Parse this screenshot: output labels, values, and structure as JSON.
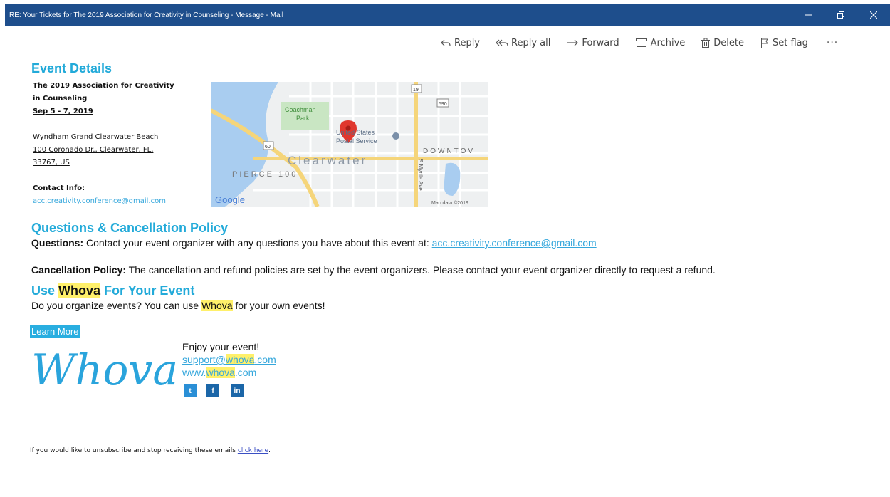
{
  "window": {
    "title": "RE: Your Tickets for The 2019 Association for Creativity in Counseling - Message - Mail",
    "controls": [
      "–",
      "❐",
      "✕"
    ]
  },
  "toolbar": {
    "reply": "Reply",
    "reply_all": "Reply all",
    "forward": "Forward",
    "archive": "Archive",
    "delete": "Delete",
    "set_flag": "Set flag",
    "more": "···"
  },
  "event": {
    "heading": "Event Details",
    "title_line1": "The 2019 Association for Creativity",
    "title_line2": "in Counseling",
    "dates": "Sep 5 - 7, 2019",
    "venue": "Wyndham Grand Clearwater Beach",
    "address_line1": "100 Coronado Dr., Clearwater, FL,",
    "address_line2": "33767, US",
    "contact_label": "Contact Info:",
    "contact_email": "acc.creativity.conference@gmail.com"
  },
  "map": {
    "labels": {
      "park": "Coachman",
      "park2": "Park",
      "post1": "United States",
      "post2": "Postal Service",
      "city": "Clearwater",
      "downtown": "DOWNTOV",
      "pierce": "PIERCE 100",
      "street": "S Myrtle Ave",
      "google": "Google",
      "attribution": "Map data ©2019",
      "route_19": "19",
      "route_590": "590",
      "route_60": "60"
    }
  },
  "policy": {
    "heading": "Questions & Cancellation Policy",
    "questions_label": "Questions:",
    "questions_text": " Contact your event organizer with any questions you have about this event at: ",
    "questions_email": "acc.creativity.conference@gmail.com",
    "cancel_label": "Cancellation Policy:",
    "cancel_text": " The cancellation and refund policies are set by the event organizers. Please contact your event organizer directly to request a refund."
  },
  "whova": {
    "heading_use": "Use ",
    "heading_whova": "Whova",
    "heading_rest": " For Your Event",
    "promo_pre": "Do you organize events? You can use ",
    "promo_whova": "Whova",
    "promo_post": " for your own events!",
    "learn_more": "Learn More",
    "logo_text": "Whova",
    "enjoy": "Enjoy your event!",
    "support_pre": "support@",
    "support_whova": "whova",
    "support_post": ".com",
    "www_pre": "www.",
    "www_whova": "whova",
    "www_post": ".com",
    "social": [
      "t",
      "f",
      "in"
    ]
  },
  "footer": {
    "unsub_text": "If you would like to unsubscribe and stop receiving these emails ",
    "unsub_link": "click here",
    "unsub_end": "."
  },
  "colors": {
    "titlebar": "#1e4e8c",
    "heading": "#22aad9",
    "link": "#35a7dc",
    "highlight": "#fff06a",
    "learn_more": "#29aee0"
  }
}
